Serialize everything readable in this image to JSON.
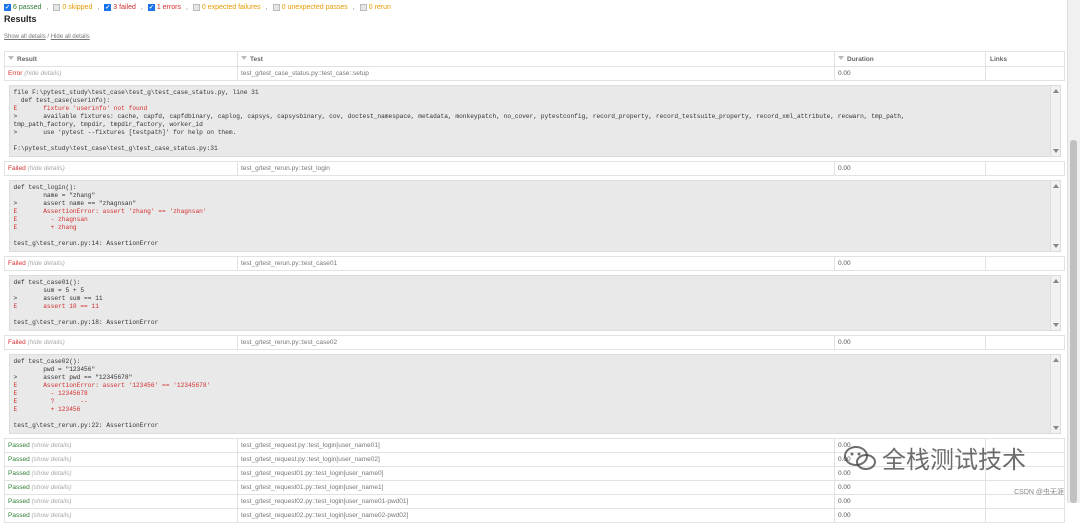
{
  "filters": [
    {
      "label": "6 passed",
      "cls": "c-passed",
      "state": "checked"
    },
    {
      "label": "0 skipped",
      "cls": "c-skipped",
      "state": "disabled"
    },
    {
      "label": "3 failed",
      "cls": "c-failed",
      "state": "checked"
    },
    {
      "label": "1 errors",
      "cls": "c-errors",
      "state": "checked"
    },
    {
      "label": "0 expected failures",
      "cls": "c-xfail",
      "state": "disabled"
    },
    {
      "label": "0 unexpected passes",
      "cls": "c-xpass",
      "state": "disabled"
    },
    {
      "label": "0 rerun",
      "cls": "c-rerun",
      "state": "disabled"
    }
  ],
  "heading": "Results",
  "toggles": {
    "show": "Show all details",
    "sep": "/",
    "hide": "Hide all details"
  },
  "columns": {
    "result": "Result",
    "test": "Test",
    "duration": "Duration",
    "links": "Links"
  },
  "rows": [
    {
      "result": "Error",
      "result_color": "#d32f2f",
      "hint": "(hide details)",
      "test": "test_g/test_case_status.py::test_case::setup",
      "duration": "0.00",
      "log": [
        {
          "t": "file F:\\pytest_study\\test_case\\test_g\\test_case_status.py, line 31",
          "e": false
        },
        {
          "t": "  def test_case(userinfo):",
          "e": false
        },
        {
          "t": "E       fixture 'userinfo' not found",
          "e": true
        },
        {
          "t": ">       available fixtures: cache, capfd, capfdbinary, caplog, capsys, capsysbinary, cov, doctest_namespace, metadata, monkeypatch, no_cover, pytestconfig, record_property, record_testsuite_property, record_xml_attribute, recwarn, tmp_path,",
          "e": false
        },
        {
          "t": "tmp_path_factory, tmpdir, tmpdir_factory, worker_id",
          "e": false
        },
        {
          "t": ">       use 'pytest --fixtures [testpath]' for help on them.",
          "e": false
        },
        {
          "t": "",
          "e": false
        },
        {
          "t": "F:\\pytest_study\\test_case\\test_g\\test_case_status.py:31",
          "e": false
        }
      ]
    },
    {
      "result": "Failed",
      "result_color": "#d32f2f",
      "hint": "(hide details)",
      "test": "test_g/test_rerun.py::test_login",
      "duration": "0.00",
      "log": [
        {
          "t": "def test_login():",
          "e": false
        },
        {
          "t": "        name = \"zhang\"",
          "e": false
        },
        {
          "t": ">       assert name == \"zhagnsan\"",
          "e": false
        },
        {
          "t": "E       AssertionError: assert 'zhang' == 'zhagnsan'",
          "e": true
        },
        {
          "t": "E         - zhagnsan",
          "e": true
        },
        {
          "t": "E         + zhang",
          "e": true
        },
        {
          "t": "",
          "e": false
        },
        {
          "t": "test_g\\test_rerun.py:14: AssertionError",
          "e": false
        }
      ]
    },
    {
      "result": "Failed",
      "result_color": "#d32f2f",
      "hint": "(hide details)",
      "test": "test_g/test_rerun.py::test_case01",
      "duration": "0.00",
      "log": [
        {
          "t": "def test_case01():",
          "e": false
        },
        {
          "t": "        sum = 5 + 5",
          "e": false
        },
        {
          "t": ">       assert sum == 11",
          "e": false
        },
        {
          "t": "E       assert 10 == 11",
          "e": true
        },
        {
          "t": "",
          "e": false
        },
        {
          "t": "test_g\\test_rerun.py:18: AssertionError",
          "e": false
        }
      ]
    },
    {
      "result": "Failed",
      "result_color": "#d32f2f",
      "hint": "(hide details)",
      "test": "test_g/test_rerun.py::test_case02",
      "duration": "0.00",
      "log": [
        {
          "t": "def test_case02():",
          "e": false
        },
        {
          "t": "        pwd = \"123456\"",
          "e": false
        },
        {
          "t": ">       assert pwd == \"12345678\"",
          "e": false
        },
        {
          "t": "E       AssertionError: assert '123456' == '12345678'",
          "e": true
        },
        {
          "t": "E         - 12345678",
          "e": true
        },
        {
          "t": "E         ?       --",
          "e": true
        },
        {
          "t": "E         + 123456",
          "e": true
        },
        {
          "t": "",
          "e": false
        },
        {
          "t": "test_g\\test_rerun.py:22: AssertionError",
          "e": false
        }
      ]
    },
    {
      "result": "Passed",
      "result_color": "#2e7d32",
      "hint": "(show details)",
      "test": "test_g/test_request.py::test_login[user_name01]",
      "duration": "0.00",
      "log": null
    },
    {
      "result": "Passed",
      "result_color": "#2e7d32",
      "hint": "(show details)",
      "test": "test_g/test_request.py::test_login[user_name02]",
      "duration": "0.00",
      "log": null
    },
    {
      "result": "Passed",
      "result_color": "#2e7d32",
      "hint": "(show details)",
      "test": "test_g/test_request01.py::test_login[user_name0]",
      "duration": "0.00",
      "log": null
    },
    {
      "result": "Passed",
      "result_color": "#2e7d32",
      "hint": "(show details)",
      "test": "test_g/test_request01.py::test_login[user_name1]",
      "duration": "0.00",
      "log": null
    },
    {
      "result": "Passed",
      "result_color": "#2e7d32",
      "hint": "(show details)",
      "test": "test_g/test_request02.py::test_login[user_name01-pwd01]",
      "duration": "0.00",
      "log": null
    },
    {
      "result": "Passed",
      "result_color": "#2e7d32",
      "hint": "(show details)",
      "test": "test_g/test_request02.py::test_login[user_name02-pwd02]",
      "duration": "0.00",
      "log": null
    }
  ],
  "watermark": "全栈测试技术",
  "credit": "CSDN @虫无涯"
}
